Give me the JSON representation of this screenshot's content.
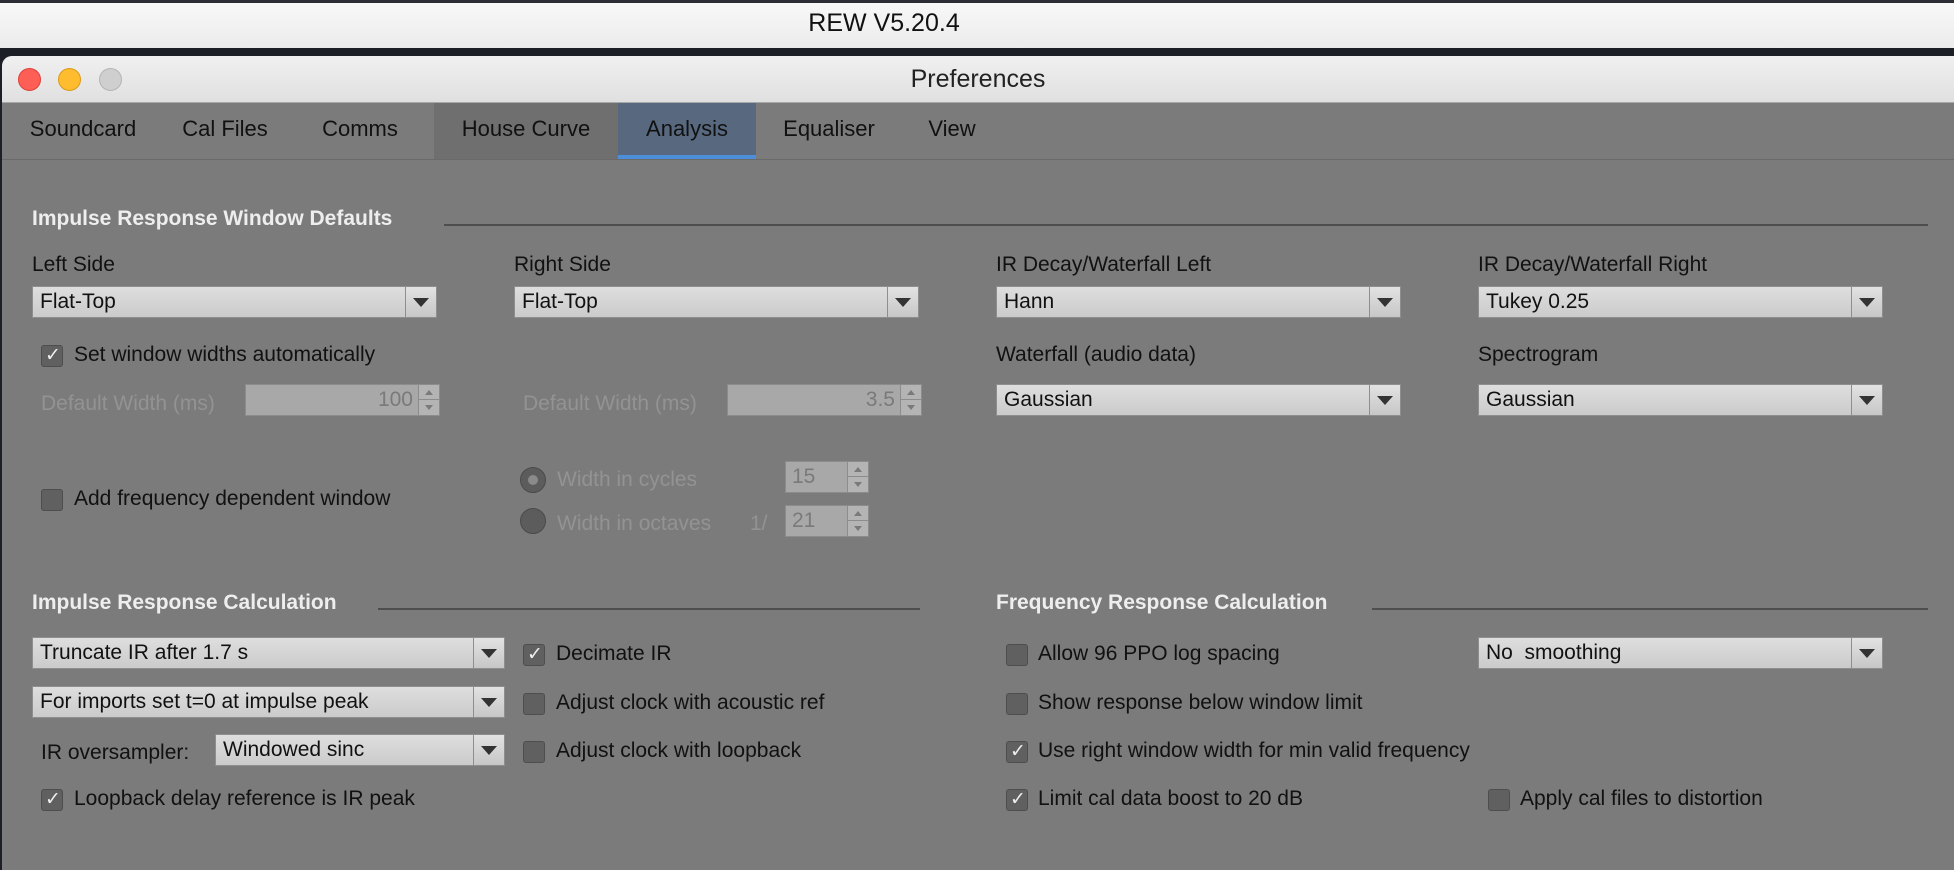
{
  "app": {
    "title": "REW V5.20.4"
  },
  "dialog": {
    "title": "Preferences"
  },
  "tabs": [
    {
      "label": "Soundcard"
    },
    {
      "label": "Cal Files"
    },
    {
      "label": "Comms"
    },
    {
      "label": "House Curve"
    },
    {
      "label": "Analysis"
    },
    {
      "label": "Equaliser"
    },
    {
      "label": "View"
    }
  ],
  "active_tab": "Analysis",
  "colors": {
    "background": "#7b7b7b",
    "active_tab": "#58697f",
    "active_tab_underline": "#4c8fd8"
  },
  "ir_window": {
    "title": "Impulse Response Window Defaults",
    "left_side": {
      "label": "Left Side",
      "value": "Flat-Top"
    },
    "right_side": {
      "label": "Right Side",
      "value": "Flat-Top"
    },
    "ir_decay_left": {
      "label": "IR Decay/Waterfall Left",
      "value": "Hann"
    },
    "ir_decay_right": {
      "label": "IR Decay/Waterfall Right",
      "value": "Tukey 0.25"
    },
    "auto_width": {
      "label": "Set window widths automatically",
      "checked": "✓"
    },
    "waterfall_audio": {
      "label": "Waterfall (audio data)",
      "value": "Gaussian"
    },
    "spectrogram": {
      "label": "Spectrogram",
      "value": "Gaussian"
    },
    "left_width": {
      "label": "Default Width (ms)",
      "value": "100"
    },
    "right_width": {
      "label": "Default Width (ms)",
      "value": "3.5"
    },
    "freq_dep": {
      "label": "Add frequency dependent window"
    },
    "width_cycles": {
      "label": "Width in cycles",
      "value": "15"
    },
    "width_octaves": {
      "label": "Width in octaves",
      "prefix": "1/",
      "value": "21"
    }
  },
  "ir_calc": {
    "title": "Impulse Response Calculation",
    "truncate": {
      "value": "Truncate IR after 1.7 s"
    },
    "imports": {
      "value": "For imports set t=0 at impulse peak"
    },
    "oversampler": {
      "label": "IR oversampler:",
      "value": "Windowed sinc"
    },
    "loopback_ref": {
      "label": "Loopback delay reference is IR peak",
      "checked": "✓"
    },
    "decimate": {
      "label": "Decimate IR",
      "checked": "✓"
    },
    "acoustic_ref": {
      "label": "Adjust clock with acoustic ref"
    },
    "clock_loopback": {
      "label": "Adjust clock with loopback"
    }
  },
  "fr_calc": {
    "title": "Frequency Response Calculation",
    "ppo96": {
      "label": "Allow 96 PPO log spacing"
    },
    "smoothing": {
      "value": "No  smoothing"
    },
    "below_limit": {
      "label": "Show response below window limit"
    },
    "right_window": {
      "label": "Use right window width for min valid frequency",
      "checked": "✓"
    },
    "limit_boost": {
      "label": "Limit cal data boost to 20 dB",
      "checked": "✓"
    },
    "cal_distortion": {
      "label": "Apply cal files to distortion"
    }
  }
}
